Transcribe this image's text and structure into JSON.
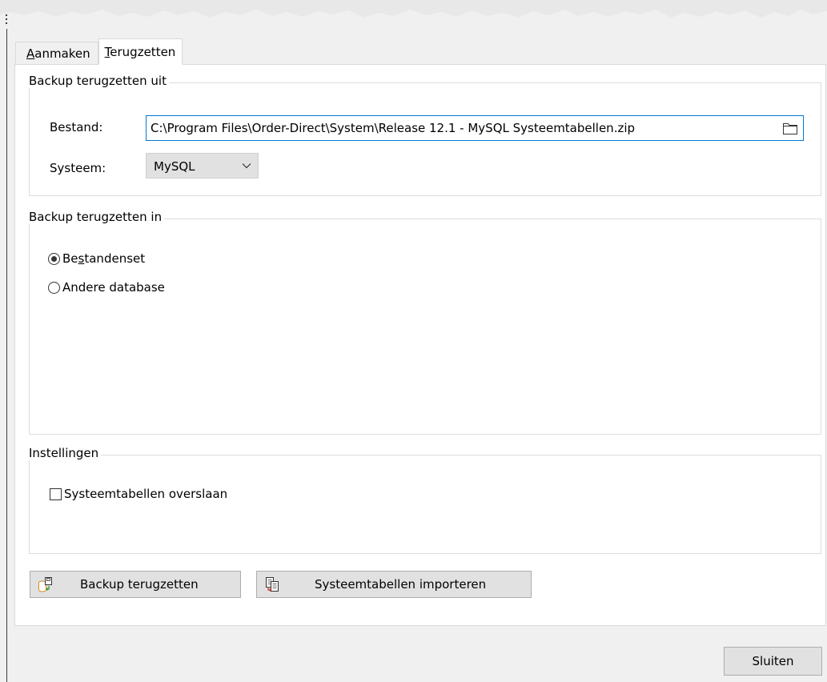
{
  "tabs": [
    {
      "label": "Aanmaken",
      "mnemonic": "A",
      "rest": "anmaken",
      "active": false
    },
    {
      "label": "Terugzetten",
      "mnemonic": "T",
      "rest": "erugzetten",
      "active": true
    }
  ],
  "source_group": {
    "title": "Backup terugzetten uit",
    "file_label": "Bestand:",
    "file_value": "C:\\Program Files\\Order-Direct\\System\\Release 12.1 - MySQL Systeemtabellen.zip",
    "system_label": "Systeem:",
    "system_value": "MySQL"
  },
  "target_group": {
    "title": "Backup terugzetten in",
    "options": [
      {
        "pre": "Be",
        "mnemonic": "s",
        "post": "tandenset",
        "checked": true
      },
      {
        "label": "Andere database",
        "checked": false
      }
    ]
  },
  "settings_group": {
    "title": "Instellingen",
    "skip_system_tables_label": "Systeemtabellen overslaan",
    "skip_system_tables_checked": false
  },
  "actions": {
    "restore_label": "Backup terugzetten",
    "import_label": "Systeemtabellen importeren"
  },
  "footer": {
    "close_label": "Sluiten"
  },
  "colors": {
    "window_bg": "#f0f0f0",
    "panel_bg": "#ffffff",
    "focus_border": "#0078d7",
    "button_bg": "#e1e1e1"
  }
}
